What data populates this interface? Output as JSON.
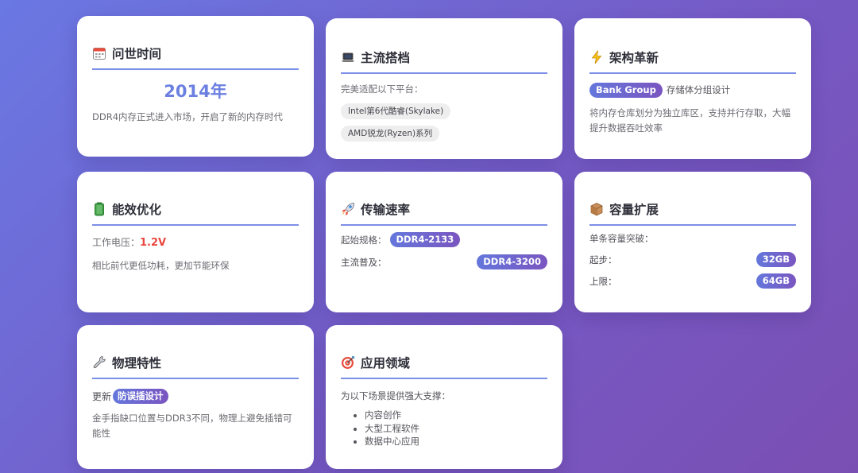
{
  "cards": {
    "release": {
      "title": "问世时间",
      "year": "2014年",
      "desc": "DDR4内存正式进入市场，开启了新的内存时代"
    },
    "platform": {
      "title": "主流搭档",
      "intro": "完美适配以下平台：",
      "tags": [
        "Intel第6代酷睿(Skylake)",
        "AMD锐龙(Ryzen)系列"
      ]
    },
    "architecture": {
      "title": "架构革新",
      "badge": "Bank Group",
      "badge_text": "存储体分组设计",
      "desc": "将内存仓库划分为独立库区，支持并行存取，大幅提升数据吞吐效率"
    },
    "efficiency": {
      "title": "能效优化",
      "voltage_label": "工作电压：",
      "voltage_value": "1.2V",
      "desc": "相比前代更低功耗，更加节能环保"
    },
    "speed": {
      "title": "传输速率",
      "start_label": "起始规格：",
      "start_value": "DDR4-2133",
      "main_label": "主流普及：",
      "main_value": "DDR4-3200"
    },
    "capacity": {
      "title": "容量扩展",
      "intro": "单条容量突破：",
      "start_label": "起步：",
      "start_value": "32GB",
      "max_label": "上限：",
      "max_value": "64GB"
    },
    "physical": {
      "title": "物理特性",
      "prefix": "更新",
      "badge": "防误插设计",
      "desc": "金手指缺口位置与DDR3不同，物理上避免插错可能性"
    },
    "applications": {
      "title": "应用领域",
      "intro": "为以下场景提供强大支撑：",
      "items": [
        "内容创作",
        "大型工程软件",
        "数据中心应用"
      ]
    }
  },
  "colors": {
    "accent": "#6b7fe0",
    "voltage": "#e8473f",
    "badge_start": "#6477dc",
    "badge_end": "#7a55c0"
  },
  "icons": [
    "calendar-icon",
    "laptop-icon",
    "lightning-icon",
    "battery-icon",
    "rocket-icon",
    "package-icon",
    "wrench-icon",
    "target-icon"
  ]
}
